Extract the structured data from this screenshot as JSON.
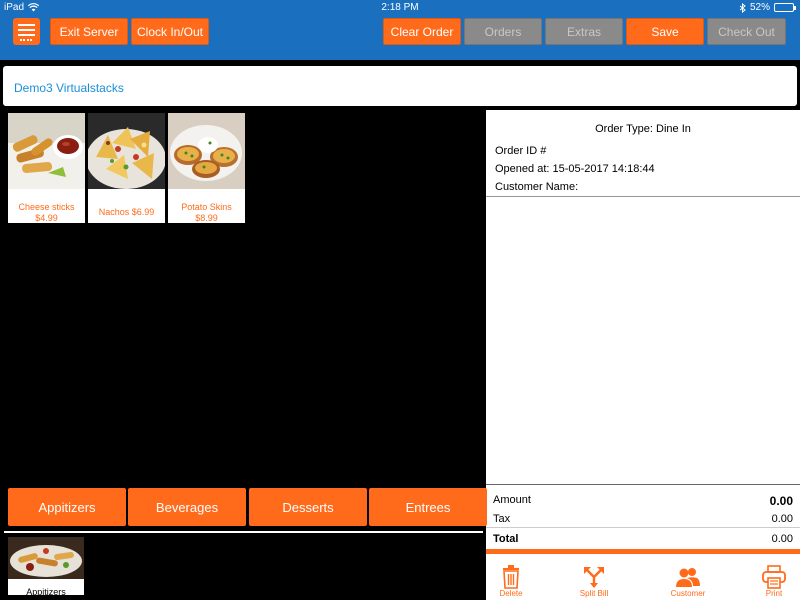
{
  "status_bar": {
    "device": "iPad",
    "time": "2:18 PM",
    "battery": "52%",
    "battery_level": 0.52
  },
  "toolbar": {
    "exit_server": "Exit Server",
    "clock_in_out": "Clock In/Out",
    "clear_order": "Clear Order",
    "orders": "Orders",
    "extras": "Extras",
    "save": "Save",
    "check_out": "Check Out"
  },
  "store": {
    "name": "Demo3 Virtualstacks"
  },
  "menu_items": [
    {
      "name": "Cheese sticks",
      "price": "$4.99"
    },
    {
      "name": "Nachos $6.99"
    },
    {
      "name": "Potato Skins",
      "price": "$8.99"
    }
  ],
  "order": {
    "type": "Order Type: Dine In",
    "id": "Order ID #",
    "opened": "Opened at: 15-05-2017 14:18:44",
    "customer": "Customer Name:",
    "amount_label": "Amount",
    "amount_value": "0.00",
    "tax_label": "Tax",
    "tax_value": "0.00",
    "total_label": "Total",
    "total_value": "0.00"
  },
  "actions": {
    "delete": "Delete",
    "split_bill": "Split Bill",
    "customer": "Customer",
    "print": "Print"
  },
  "categories": [
    "Appitizers",
    "Beverages",
    "Desserts",
    "Entrees"
  ],
  "subcategory": {
    "label": "Appitizers"
  },
  "colors": {
    "accent": "#ff6b1a",
    "header_blue": "#1a6fbf",
    "link_blue": "#1a8fd8"
  }
}
